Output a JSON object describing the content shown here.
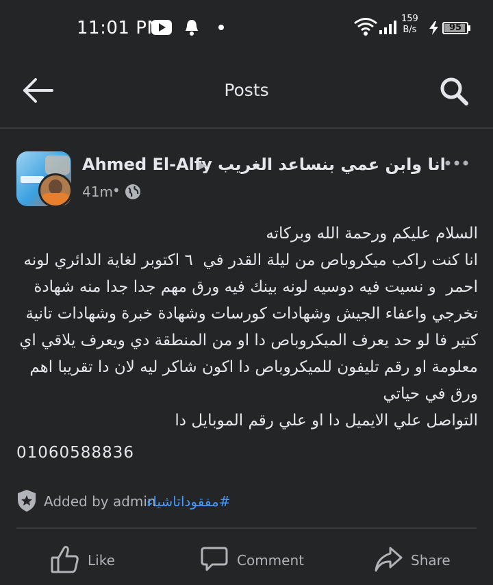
{
  "status_bar": {
    "time": "11:01 PM",
    "net_speed_value": "159",
    "net_speed_unit": "B/s",
    "battery_level": "95",
    "icons": [
      "youtube-icon",
      "notification-bell-icon",
      "dot-icon",
      "wifi-icon",
      "signal-icon",
      "charging-icon",
      "battery-icon"
    ]
  },
  "app_bar": {
    "title": "Posts",
    "back_icon": "arrow-left-icon",
    "search_icon": "search-icon"
  },
  "post": {
    "author": "Ahmed El-Alfy",
    "group": "انا وابن عمي بنساعد الغريب",
    "time_ago": "41m",
    "separator": "•",
    "privacy_icon": "globe-icon",
    "body": "السلام عليكم ورحمة الله وبركاته\nانا كنت راكب ميكروباص من ليلة القدر في  ٦ اكتوبر لغاية الدائري لونه احمر  و نسيت فيه دوسيه لونه بينك فيه ورق مهم جدا جدا منه شهادة تخرجي واعفاء الجيش وشهادات كورسات وشهادة خبرة وشهادات تانية كتير فا لو حد يعرف الميكروباص دا او من المنطقة دي ويعرف يلاقي اي معلومة او رقم تليفون للميكروباص دا اكون شاكر ليه لان دا تقريبا اهم ورق في حياتي\nالتواصل علي الايميل دا او علي رقم الموبايل دا",
    "phone": "01060588836",
    "added_by": "Added by admin",
    "hashtag": "#مفقوداتاشياء"
  },
  "actions": {
    "like": "Like",
    "comment": "Comment",
    "share": "Share"
  },
  "colors": {
    "background": "#242526",
    "text": "#e4e6eb",
    "secondary_text": "#b0b3b8",
    "link": "#4599ff"
  }
}
